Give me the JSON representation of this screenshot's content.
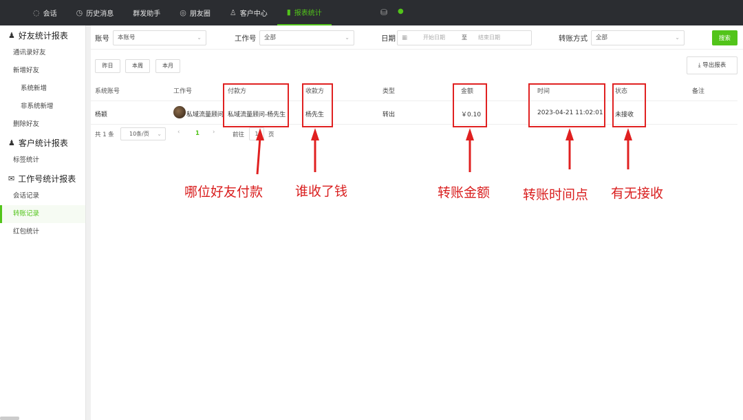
{
  "nav": {
    "items": [
      {
        "label": "会话",
        "icon": "chat-icon"
      },
      {
        "label": "历史消息",
        "icon": "history-icon"
      },
      {
        "label": "群发助手",
        "icon": ""
      },
      {
        "label": "朋友圈",
        "icon": "moments-icon"
      },
      {
        "label": "客户中心",
        "icon": "user-icon"
      },
      {
        "label": "报表统计",
        "icon": "bar-chart-icon",
        "active": true
      }
    ]
  },
  "sidebar": {
    "groups": [
      {
        "title": "好友统计报表",
        "icon": "user-icon"
      },
      {
        "title": "客户统计报表",
        "icon": "user-icon"
      },
      {
        "title": "工作号统计报表",
        "icon": "wechat-icon"
      }
    ],
    "items": {
      "contacts_friends": "通讯录好友",
      "new_friends": "新增好友",
      "system_new": "系统新增",
      "non_system_new": "非系统新增",
      "deleted_friends": "删除好友",
      "tag_stats": "标签统计",
      "chat_records": "会话记录",
      "transfer_records": "转账记录",
      "red_packet_stats": "红包统计"
    }
  },
  "filter": {
    "account_label": "账号",
    "account_value": "本账号",
    "work_label": "工作号",
    "work_value": "全部",
    "date_label": "日期",
    "date_start_placeholder": "开始日期",
    "date_sep": "至",
    "date_end_placeholder": "结束日期",
    "transfer_label": "转账方式",
    "transfer_value": "全部",
    "search_label": "搜索"
  },
  "quick": {
    "yesterday": "昨日",
    "this_week": "本周",
    "this_month": "本月",
    "export": "导出报表"
  },
  "table": {
    "headers": [
      "系统账号",
      "工作号",
      "付款方",
      "收款方",
      "类型",
      "金额",
      "时间",
      "状态",
      "备注"
    ],
    "rows": [
      {
        "system_account": "杨颖",
        "work_account": "私域流量顾问",
        "payer": "私域流量顾问-杨先生",
        "payee": "杨先生",
        "type": "转出",
        "amount": "￥0.10",
        "time": "2023-04-21 11:02:01",
        "status": "未接收",
        "remark": ""
      }
    ]
  },
  "pagination": {
    "total": "共 1 条",
    "page_size": "10条/页",
    "prev": "‹",
    "current": "1",
    "next": "›",
    "goto": "前往",
    "goto_value": "1",
    "page_suffix": "页"
  },
  "annotations": {
    "payer": "哪位好友付款",
    "payee": "谁收了钱",
    "amount": "转账金额",
    "time": "转账时间点",
    "status": "有无接收"
  },
  "colors": {
    "accent": "#52c41a",
    "annotation": "#e02020",
    "topbar": "#2b2d31"
  }
}
